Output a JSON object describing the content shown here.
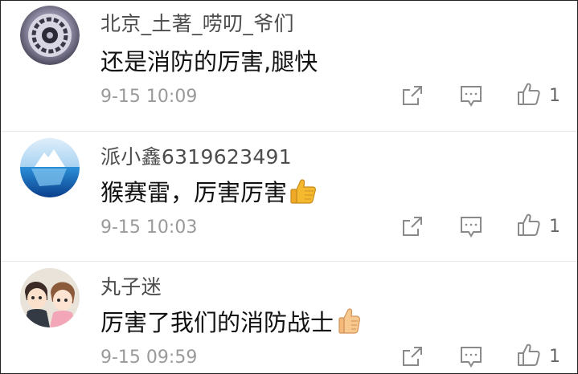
{
  "comments": [
    {
      "username": "北京_土著_唠叨_爷们",
      "text": "还是消防的厉害,腿快",
      "time": "9-15 10:09",
      "like_count": "1",
      "avatar_icon": "gear-ring-avatar-icon",
      "emoji": null
    },
    {
      "username": "派小鑫6319623491",
      "text": "猴赛雷，厉害厉害",
      "time": "9-15 10:03",
      "like_count": "1",
      "avatar_icon": "iceberg-avatar-icon",
      "emoji": "thumbs-up-emoji"
    },
    {
      "username": "丸子迷",
      "text": "厉害了我们的消防战士",
      "time": "9-15 09:59",
      "like_count": "1",
      "avatar_icon": "cartoon-couple-avatar-icon",
      "emoji": "thumbs-up-emoji"
    }
  ],
  "icons": {
    "share": "share-icon",
    "reply": "comment-reply-icon",
    "like": "thumbs-up-icon"
  },
  "colors": {
    "username": "#4d4d4d",
    "text": "#111111",
    "time": "#9a9a9a",
    "icon": "#8a8a8a",
    "emoji": "#f5b930"
  }
}
